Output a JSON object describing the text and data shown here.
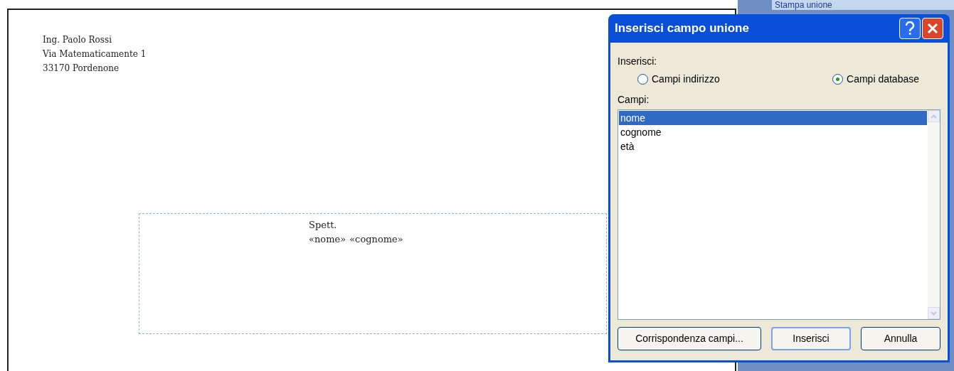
{
  "document": {
    "sender_lines": [
      "Ing. Paolo Rossi",
      "Via Matematicamente 1",
      "33170 Pordenone"
    ],
    "recipient": {
      "salutation": "Spett.",
      "fields": [
        "«nome»",
        "«cognome»"
      ]
    }
  },
  "task_pane": {
    "title": "Stampa unione"
  },
  "dialog": {
    "title": "Inserisci campo unione",
    "insert_label": "Inserisci:",
    "options": [
      {
        "label": "Campi indirizzo",
        "selected": false
      },
      {
        "label": "Campi database",
        "selected": true
      }
    ],
    "fields_label": "Campi:",
    "fields": [
      {
        "label": "nome",
        "selected": true
      },
      {
        "label": "cognome",
        "selected": false
      },
      {
        "label": "età",
        "selected": false
      }
    ],
    "buttons": [
      {
        "label": "Corrispondenza campi...",
        "default": false
      },
      {
        "label": "Inserisci",
        "default": true
      },
      {
        "label": "Annulla",
        "default": false
      }
    ]
  }
}
